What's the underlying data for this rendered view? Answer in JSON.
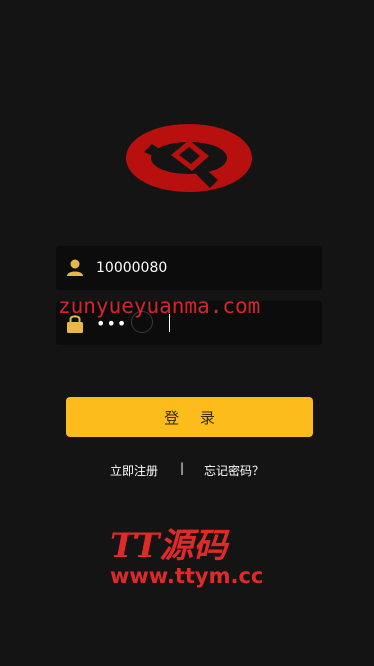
{
  "brand": {
    "logo_icon": "bank-logo-icon",
    "logo_color": "#b80f0f"
  },
  "login_form": {
    "username": {
      "icon": "user-icon",
      "value": "10000080"
    },
    "password": {
      "icon": "lock-icon",
      "value": "•••"
    },
    "submit_label": "登 录"
  },
  "links": {
    "register": "立即注册",
    "separator": "|",
    "forgot": "忘记密码？"
  },
  "watermarks": {
    "top": "zunyueyuanma.com",
    "logo": "TT源码",
    "url": "www.ttym.cc"
  },
  "colors": {
    "background": "#141414",
    "field": "#0c0c0c",
    "accent": "#fbbc1c",
    "watermark": "#e02a2a"
  }
}
